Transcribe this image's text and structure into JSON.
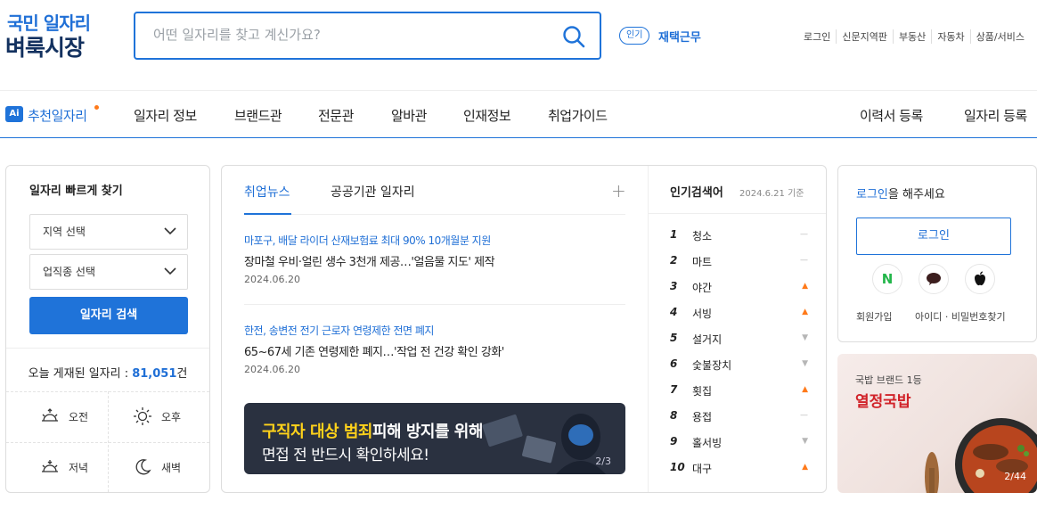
{
  "header": {
    "logo_top": "국민 일자리",
    "logo_bottom": "벼룩시장",
    "search_placeholder": "어떤 일자리를 찾고 계신가요?",
    "popular_badge": "인기",
    "popular_keyword": "재택근무",
    "util_links": [
      "로그인",
      "신문지역판",
      "부동산",
      "자동차",
      "상품/서비스"
    ]
  },
  "nav": {
    "ai_badge": "Ai",
    "ai_label": "추천일자리",
    "items": [
      "일자리 정보",
      "브랜드관",
      "전문관",
      "알바관",
      "인재정보",
      "취업가이드"
    ],
    "right_items": [
      "이력서 등록",
      "일자리 등록"
    ]
  },
  "quick_search": {
    "title": "일자리 빠르게 찾기",
    "region_select": "지역 선택",
    "job_select": "업직종 선택",
    "search_button": "일자리 검색",
    "today_label": "오늘 게재된 일자리 : ",
    "today_count": "81,051",
    "today_unit": "건",
    "shifts": [
      "오전",
      "오후",
      "저녁",
      "새벽"
    ]
  },
  "news": {
    "tabs": [
      "취업뉴스",
      "공공기관 일자리"
    ],
    "items": [
      {
        "headline": "마포구, 배달 라이더 산재보험료 최대 90% 10개월분 지원",
        "sub": "장마철 우비·얼린 생수 3천개 제공…'얼음물 지도' 제작",
        "date": "2024.06.20"
      },
      {
        "headline": "한전, 송변전 전기 근로자 연령제한 전면 폐지",
        "sub": "65~67세 기존 연령제한 폐지…'작업 전 건강 확인 강화'",
        "date": "2024.06.20"
      }
    ],
    "banner": {
      "highlight": "구직자 대상 범죄",
      "line1_rest": "피해 방지를 위해",
      "line2": "면접 전 반드시 확인하세요!",
      "page": "2/3"
    }
  },
  "ranking": {
    "title": "인기검색어",
    "date": "2024.6.21 기준",
    "items": [
      {
        "rank": "1",
        "word": "청소",
        "trend": "same"
      },
      {
        "rank": "2",
        "word": "마트",
        "trend": "same"
      },
      {
        "rank": "3",
        "word": "야간",
        "trend": "up"
      },
      {
        "rank": "4",
        "word": "서빙",
        "trend": "up"
      },
      {
        "rank": "5",
        "word": "설거지",
        "trend": "down"
      },
      {
        "rank": "6",
        "word": "숯불장치",
        "trend": "down"
      },
      {
        "rank": "7",
        "word": "횟집",
        "trend": "up"
      },
      {
        "rank": "8",
        "word": "용접",
        "trend": "same"
      },
      {
        "rank": "9",
        "word": "홀서빙",
        "trend": "down"
      },
      {
        "rank": "10",
        "word": "대구",
        "trend": "up"
      }
    ]
  },
  "login": {
    "msg_link": "로그인",
    "msg_rest": "을 해주세요",
    "button": "로그인",
    "sns": [
      "N",
      "●",
      ""
    ],
    "join": "회원가입",
    "find": "아이디 · 비밀번호찾기"
  },
  "brand_banner": {
    "small": "국밥 브랜드 1등",
    "big": "열정국밥",
    "page": "2/44"
  },
  "colors": {
    "accent": "#1f73d9",
    "up": "#ff7a1a",
    "brand_red": "#d1232a"
  }
}
